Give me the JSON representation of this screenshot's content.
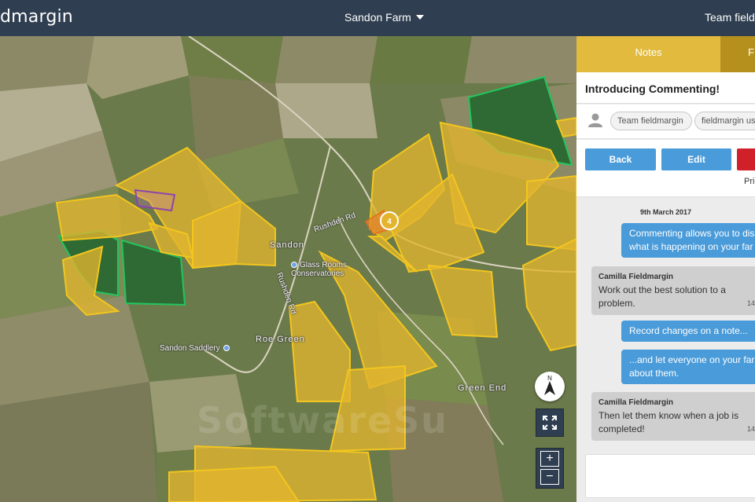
{
  "header": {
    "logo": "dmargin",
    "farm": "Sandon Farm",
    "team": "Team fieldmargin"
  },
  "map": {
    "labels": {
      "sandon": "Sandon",
      "glass_rooms": "Glass Rooms Conservatories",
      "rushden_rd_1": "Rushden Rd",
      "rushden_rd_2": "Rushden Rd",
      "sandon_saddlery": "Sandon Saddlery",
      "roe_green": "Roe Green",
      "green_end": "Green End"
    },
    "badge_count": "4",
    "compass_label": "N",
    "zoom_in": "+",
    "zoom_out": "−",
    "watermark": "SoftwareSu",
    "colors": {
      "field_fill": "#e3b52e",
      "field_stroke": "#f2c61f",
      "forest_stroke": "#22c55e",
      "selected_stroke": "#8e44ad"
    }
  },
  "panel": {
    "tabs": {
      "notes": "Notes",
      "fields": "F"
    },
    "note_title": "Introducing Commenting!",
    "assignees": [
      "Team fieldmargin",
      "fieldmargin us"
    ],
    "buttons": {
      "back": "Back",
      "edit": "Edit"
    },
    "priority": "Pri",
    "chat": {
      "date": "9th March 2017",
      "messages": [
        {
          "type": "out",
          "text_1": "Commenting allows you to dis",
          "text_2": "what is happening on your far"
        },
        {
          "type": "in",
          "author": "Camilla Fieldmargin",
          "text_1": "Work out the best solution to a",
          "text_2": "problem.",
          "time": "14"
        },
        {
          "type": "out",
          "text_1": "Record changes on a note..."
        },
        {
          "type": "out",
          "text_1": "...and let everyone on your far",
          "text_2": "about them."
        },
        {
          "type": "in",
          "author": "Camilla Fieldmargin",
          "text_1": "Then let them know when a job is",
          "text_2": "completed!",
          "time": "14"
        }
      ]
    }
  }
}
